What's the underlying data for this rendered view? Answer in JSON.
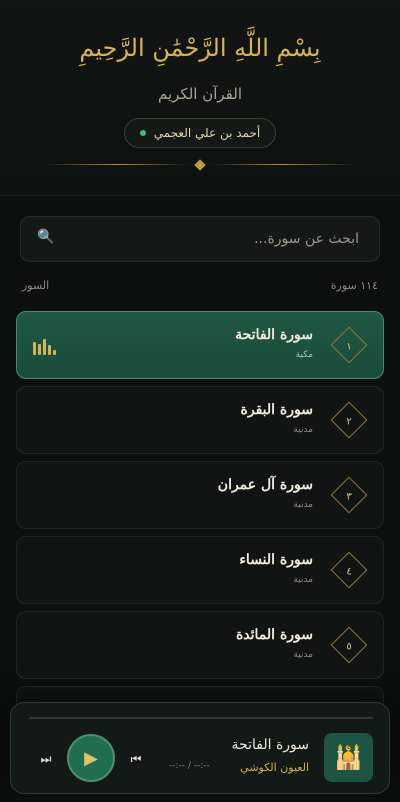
{
  "header": {
    "basmala": "بِسْمِ اللَّهِ الرَّحْمَٰنِ الرَّحِيمِ",
    "title": "القرآن الكريم",
    "reciter": "أحمد بن علي العجمي"
  },
  "search": {
    "placeholder": "ابحث عن سورة..."
  },
  "list": {
    "label": "السور",
    "count": "١١٤ سورة"
  },
  "surahs": [
    {
      "number": "١",
      "name": "سورة الفاتحة",
      "type": "مكية",
      "active": true
    },
    {
      "number": "٢",
      "name": "سورة البقرة",
      "type": "مدنية",
      "active": false
    },
    {
      "number": "٣",
      "name": "سورة آل عمران",
      "type": "مدنية",
      "active": false
    },
    {
      "number": "٤",
      "name": "سورة النساء",
      "type": "مدنية",
      "active": false
    },
    {
      "number": "٥",
      "name": "سورة المائدة",
      "type": "مدنية",
      "active": false
    }
  ],
  "player": {
    "title": "سورة الفاتحة",
    "reciter": "العيون الكوشي",
    "time": "--:-- / --:--",
    "progress": 0
  },
  "colors": {
    "accent": "#d7b452",
    "active_card": "#1f5844",
    "background": "#0d0f0e"
  },
  "icons": {
    "search": "search-icon",
    "prev": "skip-previous-icon",
    "play": "play-icon",
    "next": "skip-next-icon",
    "equalizer": "equalizer-icon",
    "cover": "mosque-icon"
  }
}
